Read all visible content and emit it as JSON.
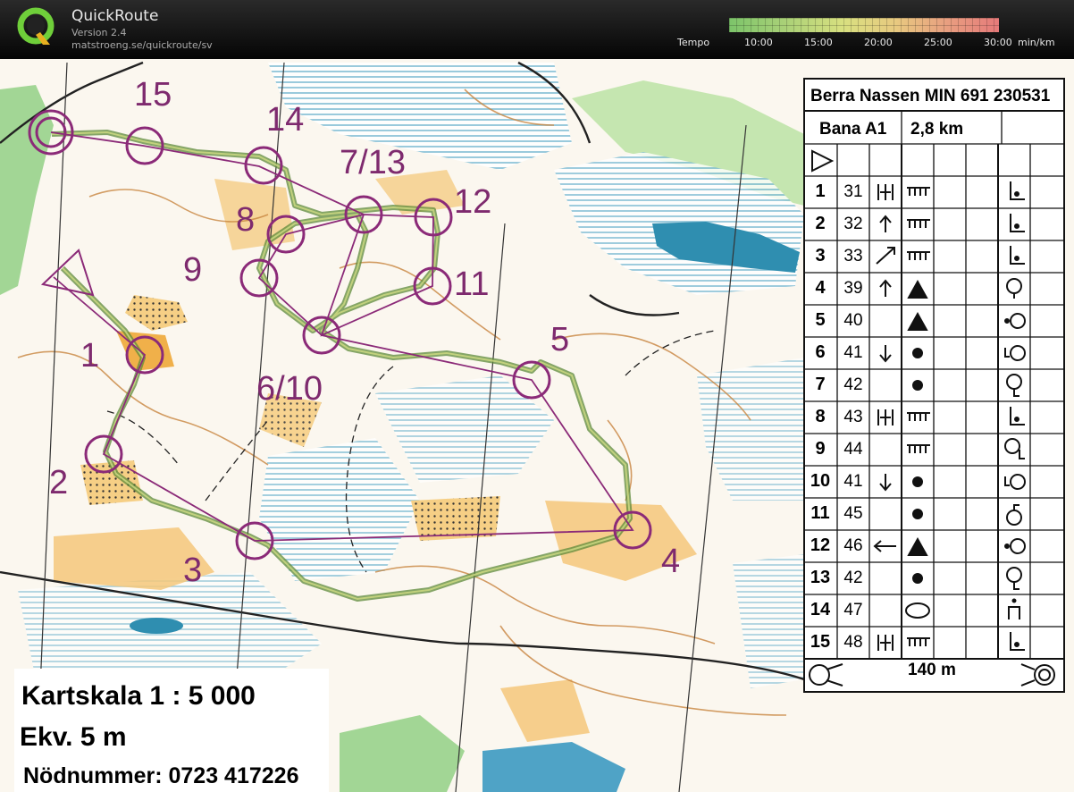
{
  "app": {
    "name": "QuickRoute",
    "version": "Version 2.4",
    "url": "matstroeng.se/quickroute/sv"
  },
  "tempo": {
    "label": "Tempo",
    "ticks": [
      "10:00",
      "15:00",
      "20:00",
      "25:00",
      "30:00"
    ],
    "unit": "min/km",
    "colors": [
      "#7cc46a",
      "#d8e080",
      "#e67a7a"
    ]
  },
  "map": {
    "control_labels": [
      "1",
      "2",
      "3",
      "4",
      "5",
      "6/10",
      "7/13",
      "8",
      "9",
      "11",
      "12",
      "14",
      "15"
    ]
  },
  "legend": {
    "scale": "Kartskala 1 : 5 000",
    "contour": "Ekv.  5 m",
    "emergency": "Nödnummer: 0723 417226"
  },
  "description": {
    "title": "Berra Nassen MIN 691 230531",
    "course": "Bana A1",
    "length": "2,8 km",
    "finish_distance": "140 m",
    "controls": [
      {
        "num": "1",
        "code": "31"
      },
      {
        "num": "2",
        "code": "32"
      },
      {
        "num": "3",
        "code": "33"
      },
      {
        "num": "4",
        "code": "39"
      },
      {
        "num": "5",
        "code": "40"
      },
      {
        "num": "6",
        "code": "41"
      },
      {
        "num": "7",
        "code": "42"
      },
      {
        "num": "8",
        "code": "43"
      },
      {
        "num": "9",
        "code": "44"
      },
      {
        "num": "10",
        "code": "41"
      },
      {
        "num": "11",
        "code": "45"
      },
      {
        "num": "12",
        "code": "46"
      },
      {
        "num": "13",
        "code": "42"
      },
      {
        "num": "14",
        "code": "47"
      },
      {
        "num": "15",
        "code": "48"
      }
    ]
  },
  "colors": {
    "course": "#8b2a78",
    "route": "#6f9a4a",
    "map_bg": "#fbf6ee"
  }
}
